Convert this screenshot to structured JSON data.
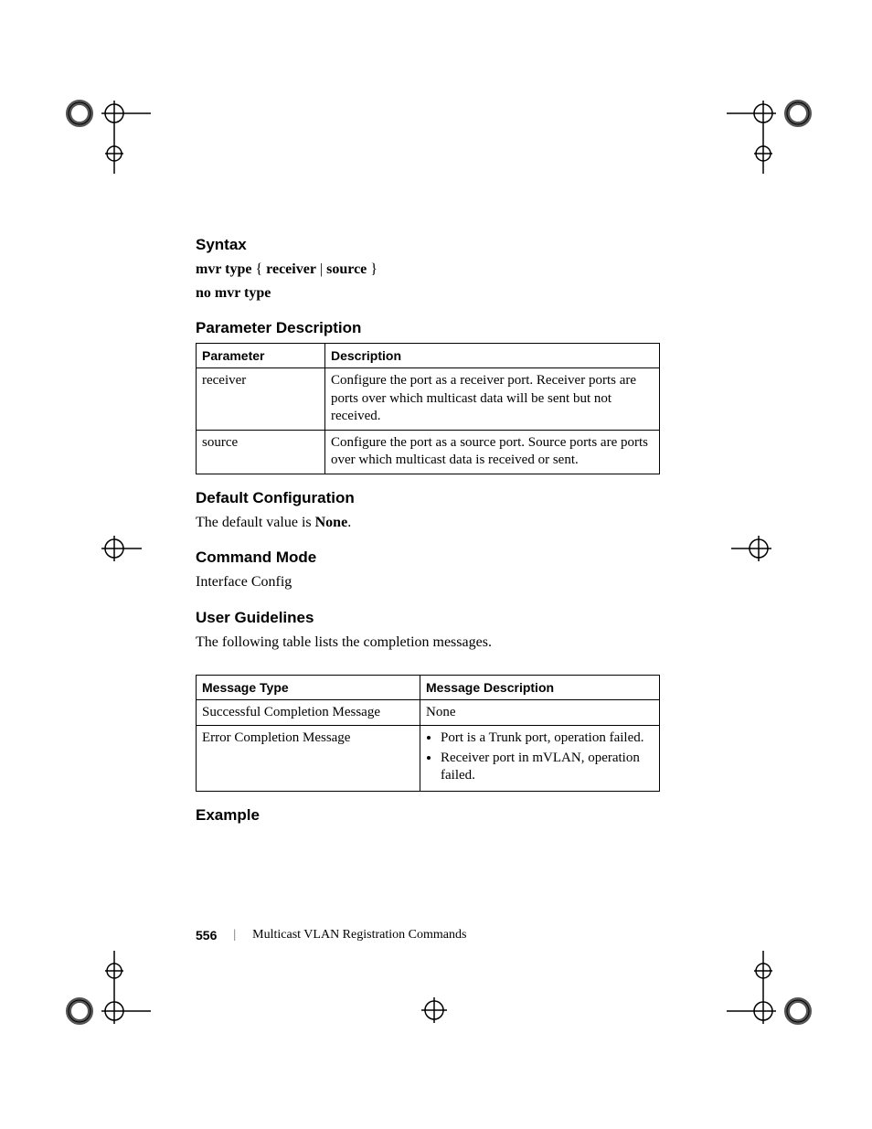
{
  "headings": {
    "syntax": "Syntax",
    "parameter_description": "Parameter Description",
    "default_configuration": "Default Configuration",
    "command_mode": "Command Mode",
    "user_guidelines": "User Guidelines",
    "example": "Example"
  },
  "syntax_line_prefix": "mvr type",
  "syntax_line_braces_open": " { ",
  "syntax_line_receiver": "receiver",
  "syntax_line_sep": " | ",
  "syntax_line_source": "source",
  "syntax_line_braces_close": " }",
  "syntax_line2": "no mvr type",
  "param_table": {
    "headers": {
      "parameter": "Parameter",
      "description": "Description"
    },
    "rows": [
      {
        "param": "receiver",
        "desc": "Configure the port as a receiver port. Receiver ports are ports over which multicast data will be sent but not received."
      },
      {
        "param": "source",
        "desc": "Configure the port as a source port. Source ports are ports over which multicast data is received or sent."
      }
    ]
  },
  "default_text_prefix": "The default value is ",
  "default_text_value": "None",
  "default_text_suffix": ".",
  "command_mode_text": "Interface Config",
  "user_guidelines_text": "The following table lists the completion messages.",
  "msg_table": {
    "headers": {
      "type": "Message Type",
      "desc": "Message Description"
    },
    "rows": [
      {
        "type": "Successful Completion Message",
        "desc_plain": "None"
      },
      {
        "type": "Error Completion Message",
        "desc_bullets": [
          "Port is a Trunk port, operation failed.",
          "Receiver port in mVLAN, operation failed."
        ]
      }
    ]
  },
  "footer": {
    "page_number": "556",
    "section_title": "Multicast VLAN Registration Commands"
  }
}
